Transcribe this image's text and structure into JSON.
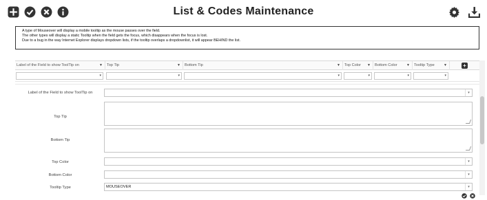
{
  "toolbar": {
    "title": "List & Codes Maintenance",
    "left_icons": [
      "plus-square-icon",
      "check-circle-icon",
      "times-circle-icon",
      "info-circle-icon"
    ],
    "right_icons": [
      "gear-icon",
      "download-icon"
    ]
  },
  "info": {
    "lines": [
      "A type of Mouseover will display a mobile tooltip as the mouse passes over the field.",
      "The other types will display a static Tooltip when the field gets the focus, which disappears when the focus is lost.",
      "Due to a bug in the way Internet Explorer displays dropdown lists, if the tooltip overlaps a dropdownlist, it will appear BEHIND the list."
    ]
  },
  "grid": {
    "columns": [
      {
        "label": "Label of the Field to show ToolTip on"
      },
      {
        "label": "Top Tip"
      },
      {
        "label": "Bottom Tip"
      },
      {
        "label": "Top Color"
      },
      {
        "label": "Bottom Color"
      },
      {
        "label": "Tooltip Type"
      }
    ],
    "sort_caret": "▼",
    "add_icon": "plus-square-icon"
  },
  "form": {
    "fields": [
      {
        "label": "Label of the Field to show ToolTip on",
        "value": "",
        "kind": "select"
      },
      {
        "label": "Top Tip",
        "value": "",
        "kind": "textarea"
      },
      {
        "label": "Bottom Tip",
        "value": "",
        "kind": "textarea"
      },
      {
        "label": "Top Color",
        "value": "",
        "kind": "select"
      },
      {
        "label": "Bottom Color",
        "value": "",
        "kind": "select"
      },
      {
        "label": "Tooltip Type",
        "value": "MOUSEOVER",
        "kind": "select"
      }
    ]
  },
  "footer_icons": [
    "check-circle-icon",
    "times-circle-icon"
  ],
  "colors": {
    "icon": "#333333",
    "border": "#c4c4c4"
  }
}
